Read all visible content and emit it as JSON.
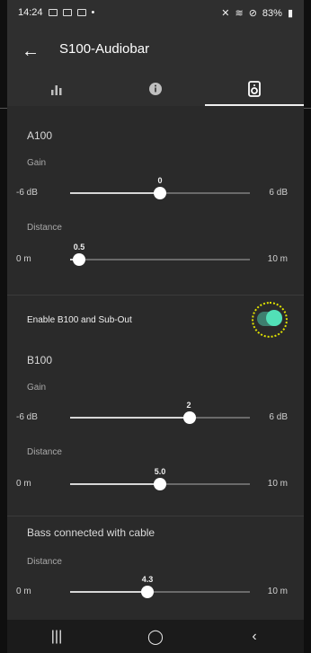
{
  "status": {
    "time": "14:24",
    "battery": "83%"
  },
  "app": {
    "title": "S100-Audiobar"
  },
  "tabs": [
    {
      "icon": "bar-chart-icon"
    },
    {
      "icon": "info-icon"
    },
    {
      "icon": "speaker-icon"
    }
  ],
  "a100": {
    "title": "A100",
    "gain_label": "Gain",
    "gain_value": "0",
    "gain_min": "-6 dB",
    "gain_max": "6 dB",
    "distance_label": "Distance",
    "distance_value": "0.5",
    "distance_min": "0 m",
    "distance_max": "10 m"
  },
  "enable": {
    "label": "Enable B100 and Sub-Out"
  },
  "b100": {
    "title": "B100",
    "gain_label": "Gain",
    "gain_value": "2",
    "gain_min": "-6 dB",
    "gain_max": "6 dB",
    "distance_label": "Distance",
    "distance_value": "5.0",
    "distance_min": "0 m",
    "distance_max": "10 m"
  },
  "bass": {
    "title": "Bass connected with cable",
    "distance_label": "Distance",
    "distance_value": "4.3",
    "distance_min": "0 m",
    "distance_max": "10 m"
  },
  "nav": {
    "recent": "|||",
    "home": "◯",
    "back": "‹"
  }
}
